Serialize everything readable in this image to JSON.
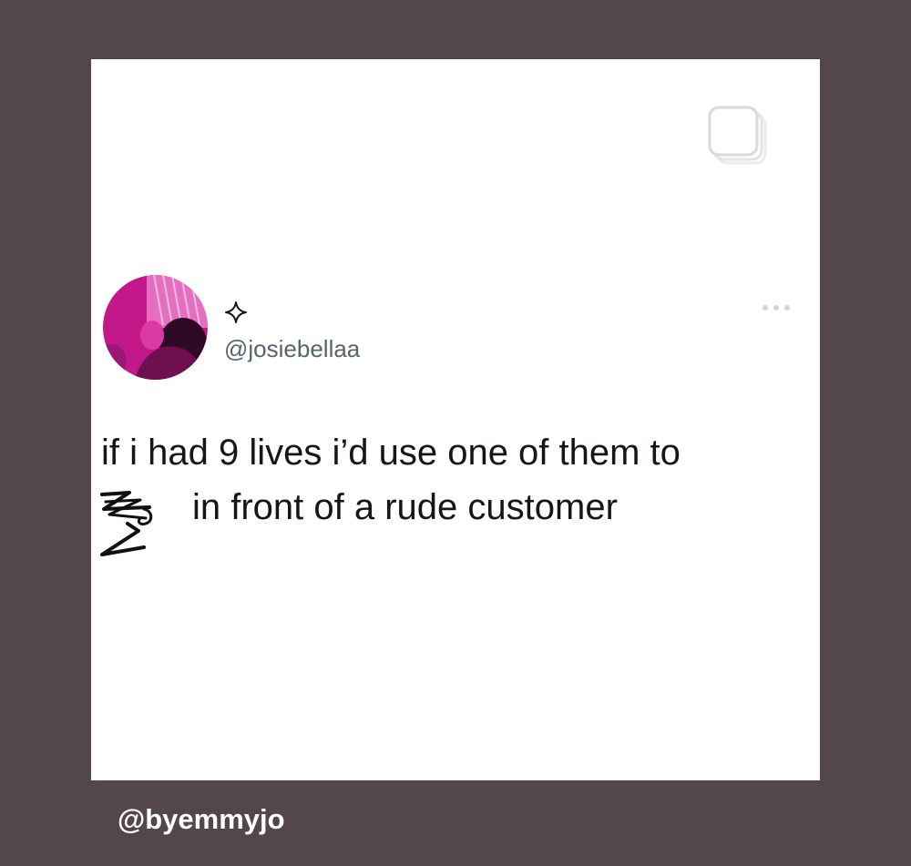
{
  "post": {
    "author_handle": "@josiebellaa",
    "text_line_1": "if i had 9 lives i’d use one of them to",
    "text_line_2": "in front of a rude customer"
  },
  "icons": {
    "multi_post": "multiple-posts-icon",
    "verified_sparkle": "sparkle-icon",
    "more_options": "more-options-icon",
    "scribble": "scribble-redaction"
  },
  "watermark": "@byemmyjo",
  "colors": {
    "background": "#54474b",
    "card": "#ffffff",
    "text": "#14171a",
    "handle": "#566470",
    "avatar_magenta": "#c2188a"
  }
}
